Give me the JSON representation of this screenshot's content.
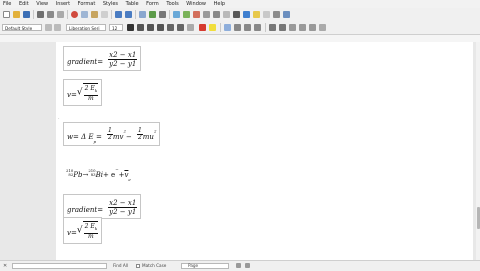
{
  "menu": [
    "File",
    "Edit",
    "View",
    "Insert",
    "Format",
    "Styles",
    "Table",
    "Form",
    "Tools",
    "Window",
    "Help"
  ],
  "toolbar": {
    "paragraph_style": "Default Style",
    "font_name": "Liberation Seri",
    "font_size": "12"
  },
  "formulas": {
    "f1": {
      "lhs": "gradient",
      "eq": "=",
      "num": "x2 − x1",
      "den": "y2 − y1"
    },
    "f2": {
      "lhs": "v",
      "eq": "=",
      "radical": "√",
      "num": "2 E",
      "num_sub": "k",
      "den": "m"
    },
    "f3": {
      "lhs": "w",
      "eq": "= Δ E",
      "sub": "p",
      "eq2": "=",
      "half1_num": "1",
      "half1_den": "2",
      "term1": "mv",
      "exp1": "2",
      "minus": "−",
      "half2_num": "1",
      "half2_den": "2",
      "term2": "mu",
      "exp2": "2"
    },
    "f4": {
      "mass1": "210",
      "z1": "82",
      "el1": "Pb",
      "arrow": "→",
      "mass2": "210",
      "z2": "83",
      "el2": "Bi",
      "plus": "+ e",
      "sup_minus": "−",
      "plus2": "+",
      "nu": "v",
      "nu_sub": "e"
    },
    "f5": {
      "lhs": "gradient",
      "eq": "=",
      "num": "x2 − x1",
      "den": "y2 − y1"
    },
    "f6": {
      "lhs": "v",
      "eq": "=",
      "radical": "√",
      "num": "2 E",
      "num_sub": "k",
      "den": "m"
    }
  },
  "findbar": {
    "find_label": "Find All",
    "match_case": "Match Case",
    "page_selector": "Page"
  },
  "colors": {
    "accent": "#3b6fb6",
    "page": "#ffffff",
    "workspace": "#e8e8e8"
  }
}
